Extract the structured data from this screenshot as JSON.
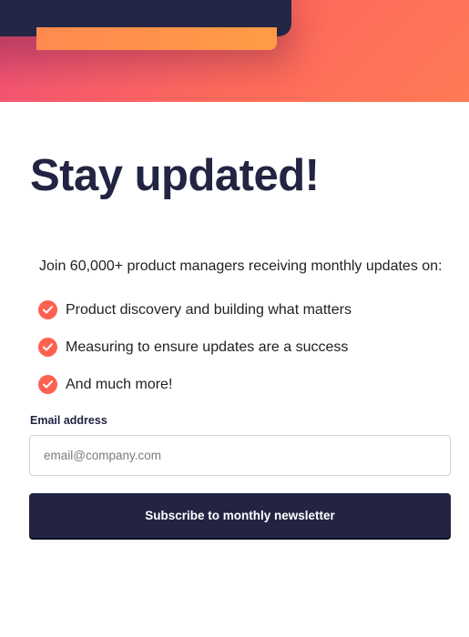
{
  "newsletter": {
    "title": "Stay updated!",
    "intro": "Join 60,000+ product managers receiving monthly updates on:",
    "bullets": [
      {
        "text": "Product discovery and building what matters",
        "icon": "check-circle-icon"
      },
      {
        "text": "Measuring to ensure updates are a success",
        "icon": "check-circle-icon"
      },
      {
        "text": "And much more!",
        "icon": "check-circle-icon"
      }
    ],
    "email_label": "Email address",
    "email_placeholder": "email@company.com",
    "email_value": "",
    "subscribe_label": "Subscribe to monthly newsletter"
  },
  "colors": {
    "primary_dark": "#222442",
    "accent": "#ff6150",
    "hero_gradient_start": "#f04e7a",
    "hero_gradient_end": "#ff7a55"
  }
}
